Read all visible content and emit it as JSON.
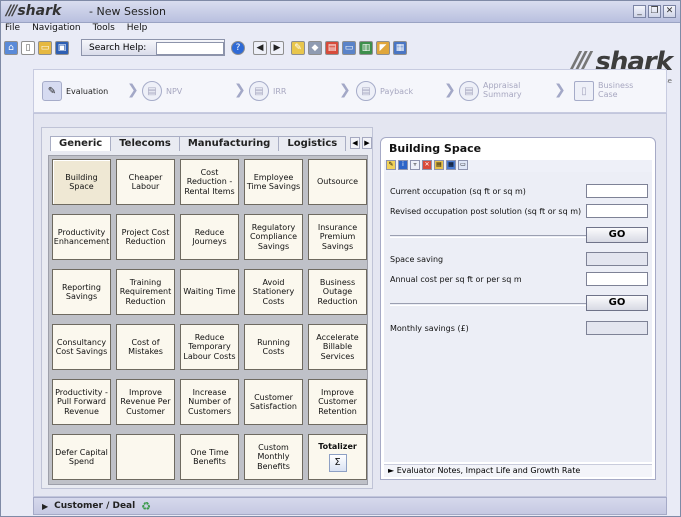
{
  "app": {
    "title": "- New Session",
    "logo": "shark",
    "brand_sub": "finesse"
  },
  "menu": [
    "File",
    "Navigation",
    "Tools",
    "Help"
  ],
  "toolbar": {
    "search_label": "Search Help:",
    "search_value": ""
  },
  "steps": [
    {
      "label": "Evaluation",
      "active": true
    },
    {
      "label": "NPV",
      "active": false
    },
    {
      "label": "IRR",
      "active": false
    },
    {
      "label": "Payback",
      "active": false
    },
    {
      "label": "Appraisal Summary",
      "active": false
    },
    {
      "label": "Business Case",
      "active": false
    }
  ],
  "tabs": [
    "Generic",
    "Telecoms",
    "Manufacturing",
    "Logistics"
  ],
  "grid": [
    [
      "Building Space",
      "Cheaper Labour",
      "Cost Reduction - Rental Items",
      "Employee Time Savings",
      "Outsource"
    ],
    [
      "Productivity Enhancement",
      "Project Cost Reduction",
      "Reduce Journeys",
      "Regulatory Compliance Savings",
      "Insurance Premium Savings"
    ],
    [
      "Reporting Savings",
      "Training Requirement Reduction",
      "Waiting Time",
      "Avoid Stationery Costs",
      "Business Outage Reduction"
    ],
    [
      "Consultancy Cost Savings",
      "Cost of Mistakes",
      "Reduce Temporary Labour Costs",
      "Running Costs",
      "Accelerate Billable Services"
    ],
    [
      "Productivity - Pull Forward Revenue",
      "Improve Revenue Per Customer",
      "Increase Number of Customers",
      "Customer Satisfaction",
      "Improve Customer Retention"
    ],
    [
      "Defer Capital Spend",
      "",
      "One Time Benefits",
      "Custom Monthly Benefits",
      "Totalizer"
    ]
  ],
  "detail": {
    "title": "Building Space",
    "current": "Current occupation (sq ft or sq m)",
    "revised": "Revised occupation post solution (sq ft or sq m)",
    "go1": "GO",
    "space_saving": "Space saving",
    "annual_cost": "Annual cost per sq ft or per sq m",
    "go2": "GO",
    "monthly": "Monthly savings (£)",
    "footer": "► Evaluator Notes, Impact Life and Growth Rate"
  },
  "footer": {
    "label": "Customer / Deal"
  }
}
